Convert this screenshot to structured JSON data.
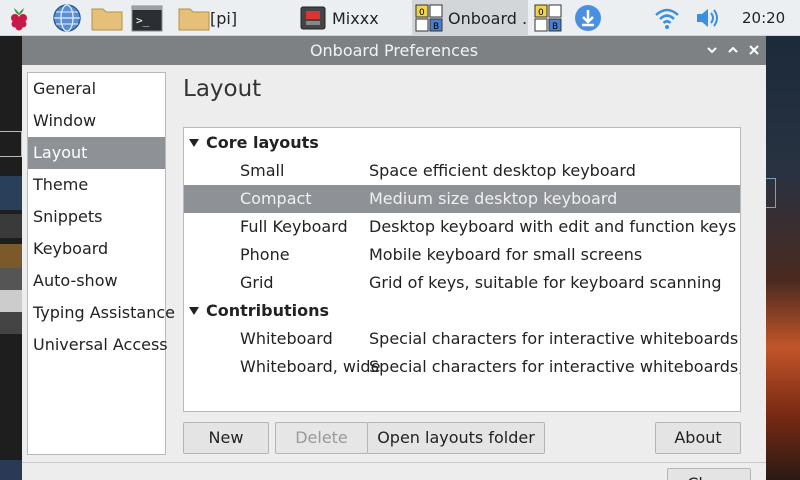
{
  "taskbar": {
    "apps": [
      {
        "label": "Mixxx"
      },
      {
        "label": "Onboard ..."
      }
    ],
    "folder_label": "[pi]",
    "clock": "20:20"
  },
  "dialog": {
    "title": "Onboard Preferences",
    "sidebar": [
      {
        "label": "General"
      },
      {
        "label": "Window"
      },
      {
        "label": "Layout"
      },
      {
        "label": "Theme"
      },
      {
        "label": "Snippets"
      },
      {
        "label": "Keyboard"
      },
      {
        "label": "Auto-show"
      },
      {
        "label": "Typing Assistance"
      },
      {
        "label": "Universal Access"
      }
    ],
    "page_title": "Layout",
    "groups": [
      {
        "name": "Core layouts",
        "items": [
          {
            "name": "Small",
            "desc": "Space efficient desktop keyboard"
          },
          {
            "name": "Compact",
            "desc": "Medium size desktop keyboard"
          },
          {
            "name": "Full Keyboard",
            "desc": "Desktop keyboard with edit and function keys"
          },
          {
            "name": "Phone",
            "desc": "Mobile keyboard for small screens"
          },
          {
            "name": "Grid",
            "desc": "Grid of keys, suitable for keyboard scanning"
          }
        ]
      },
      {
        "name": "Contributions",
        "items": [
          {
            "name": "Whiteboard",
            "desc": "Special characters for interactive whiteboards"
          },
          {
            "name": "Whiteboard, wide",
            "desc": "Special characters for interactive whiteboards, wide"
          }
        ]
      }
    ],
    "buttons": {
      "new": "New",
      "delete": "Delete",
      "open_folder": "Open layouts folder",
      "about": "About",
      "close": "Close"
    }
  },
  "colors": {
    "selection": "#8e9196",
    "titlebar": "#7e8184",
    "taskbar": "#eceff1"
  }
}
